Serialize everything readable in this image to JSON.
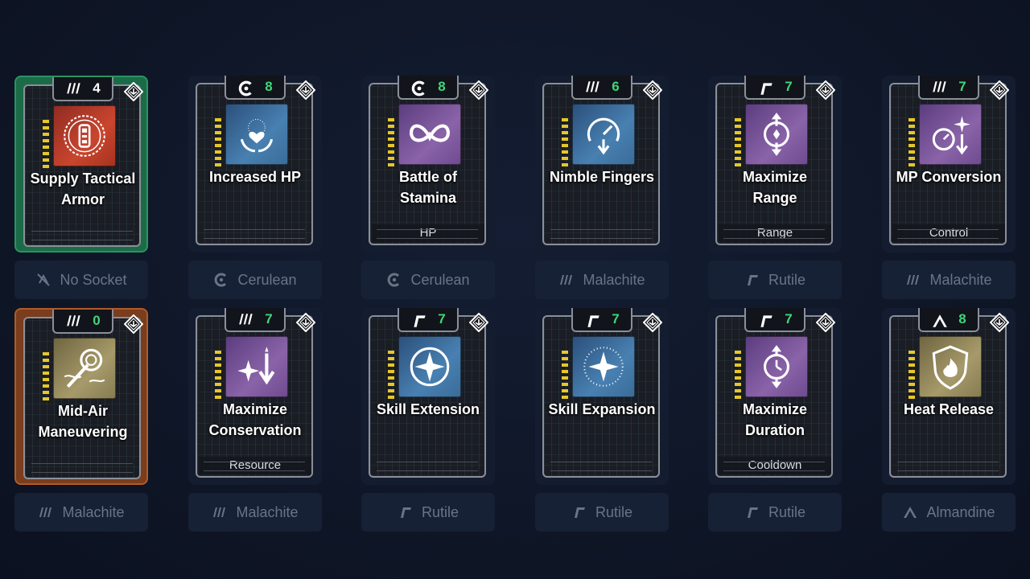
{
  "cards": [
    {
      "title": "Supply Tactical Armor",
      "type_icon": "malachite-icon",
      "count": "4",
      "count_color": "white",
      "subtitle": "",
      "socket_label": "No Socket",
      "socket_icon": "no-socket-icon",
      "icon": "armor-icon",
      "icon_color": "red",
      "frame": "green"
    },
    {
      "title": "Increased HP",
      "type_icon": "cerulean-icon",
      "count": "8",
      "count_color": "green",
      "subtitle": "",
      "socket_label": "Cerulean",
      "socket_icon": "cerulean-icon",
      "icon": "heart-hands-icon",
      "icon_color": "blue",
      "frame": "none"
    },
    {
      "title": "Battle of Stamina",
      "type_icon": "cerulean-icon",
      "count": "8",
      "count_color": "green",
      "subtitle": "HP",
      "socket_label": "Cerulean",
      "socket_icon": "cerulean-icon",
      "icon": "infinity-heart-icon",
      "icon_color": "purple",
      "frame": "none"
    },
    {
      "title": "Nimble Fingers",
      "type_icon": "malachite-icon",
      "count": "6",
      "count_color": "green",
      "subtitle": "",
      "socket_label": "Malachite",
      "socket_icon": "malachite-icon",
      "icon": "gauge-down-icon",
      "icon_color": "blue",
      "frame": "none"
    },
    {
      "title": "Maximize Range",
      "type_icon": "rutile-icon",
      "count": "7",
      "count_color": "green",
      "subtitle": "Range",
      "socket_label": "Rutile",
      "socket_icon": "rutile-icon",
      "icon": "range-arrows-icon",
      "icon_color": "purple",
      "frame": "none"
    },
    {
      "title": "MP Conversion",
      "type_icon": "malachite-icon",
      "count": "7",
      "count_color": "green",
      "subtitle": "Control",
      "socket_label": "Malachite",
      "socket_icon": "malachite-icon",
      "icon": "gauge-spark-icon",
      "icon_color": "purple",
      "frame": "none"
    },
    {
      "title": "Mid-Air Maneuvering",
      "type_icon": "malachite-icon",
      "count": "0",
      "count_color": "green",
      "subtitle": "",
      "socket_label": "Malachite",
      "socket_icon": "malachite-icon",
      "icon": "grapple-icon",
      "icon_color": "gold",
      "frame": "orange"
    },
    {
      "title": "Maximize Conservation",
      "type_icon": "malachite-icon",
      "count": "7",
      "count_color": "green",
      "subtitle": "Resource",
      "socket_label": "Malachite",
      "socket_icon": "malachite-icon",
      "icon": "spark-down-icon",
      "icon_color": "purple",
      "frame": "none"
    },
    {
      "title": "Skill Extension",
      "type_icon": "rutile-icon",
      "count": "7",
      "count_color": "green",
      "subtitle": "",
      "socket_label": "Rutile",
      "socket_icon": "rutile-icon",
      "icon": "star-circle-icon",
      "icon_color": "blue",
      "frame": "none"
    },
    {
      "title": "Skill Expansion",
      "type_icon": "rutile-icon",
      "count": "7",
      "count_color": "green",
      "subtitle": "",
      "socket_label": "Rutile",
      "socket_icon": "rutile-icon",
      "icon": "star-burst-icon",
      "icon_color": "blue",
      "frame": "none"
    },
    {
      "title": "Maximize Duration",
      "type_icon": "rutile-icon",
      "count": "7",
      "count_color": "green",
      "subtitle": "Cooldown",
      "socket_label": "Rutile",
      "socket_icon": "rutile-icon",
      "icon": "timer-arrows-icon",
      "icon_color": "purple",
      "frame": "none"
    },
    {
      "title": "Heat Release",
      "type_icon": "almandine-icon",
      "count": "8",
      "count_color": "green",
      "subtitle": "",
      "socket_label": "Almandine",
      "socket_icon": "almandine-icon",
      "icon": "shield-flame-icon",
      "icon_color": "gold",
      "frame": "none"
    }
  ]
}
